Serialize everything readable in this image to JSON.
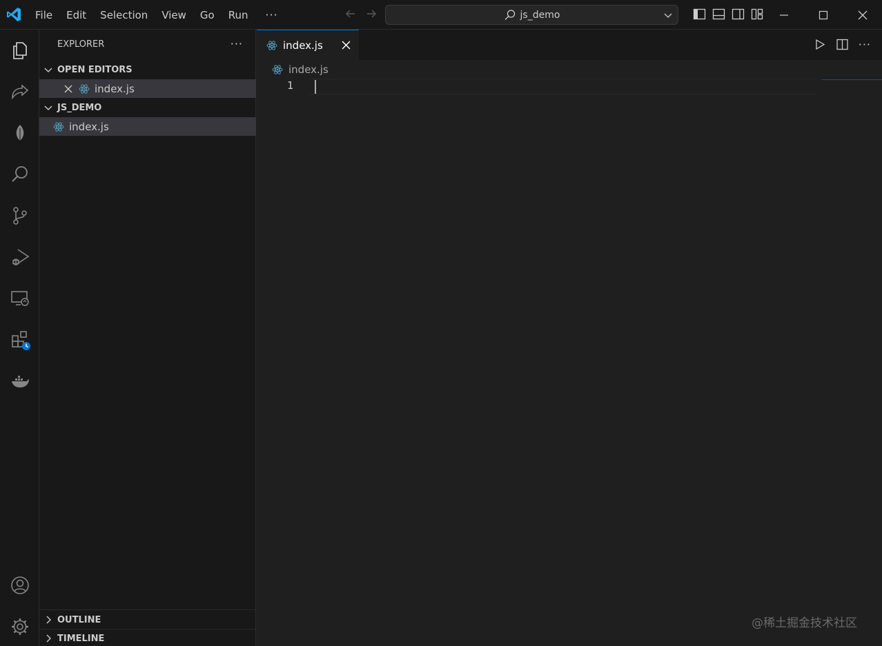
{
  "titlebar": {
    "menu": [
      "File",
      "Edit",
      "Selection",
      "View",
      "Go",
      "Run"
    ],
    "more": "···",
    "search_text": "js_demo"
  },
  "sidebar": {
    "title": "EXPLORER",
    "more": "···",
    "open_editors": {
      "label": "OPEN EDITORS",
      "items": [
        "index.js"
      ]
    },
    "folder": {
      "label": "JS_DEMO",
      "items": [
        "index.js"
      ]
    },
    "outline": "OUTLINE",
    "timeline": "TIMELINE"
  },
  "editor": {
    "tab_label": "index.js",
    "breadcrumb": "index.js",
    "line_numbers": [
      "1"
    ],
    "more": "···"
  },
  "watermark": "@稀土掘金技术社区",
  "colors": {
    "accent": "#0078d4",
    "react_icon": "#519aba",
    "logo": "#23a9f2"
  }
}
